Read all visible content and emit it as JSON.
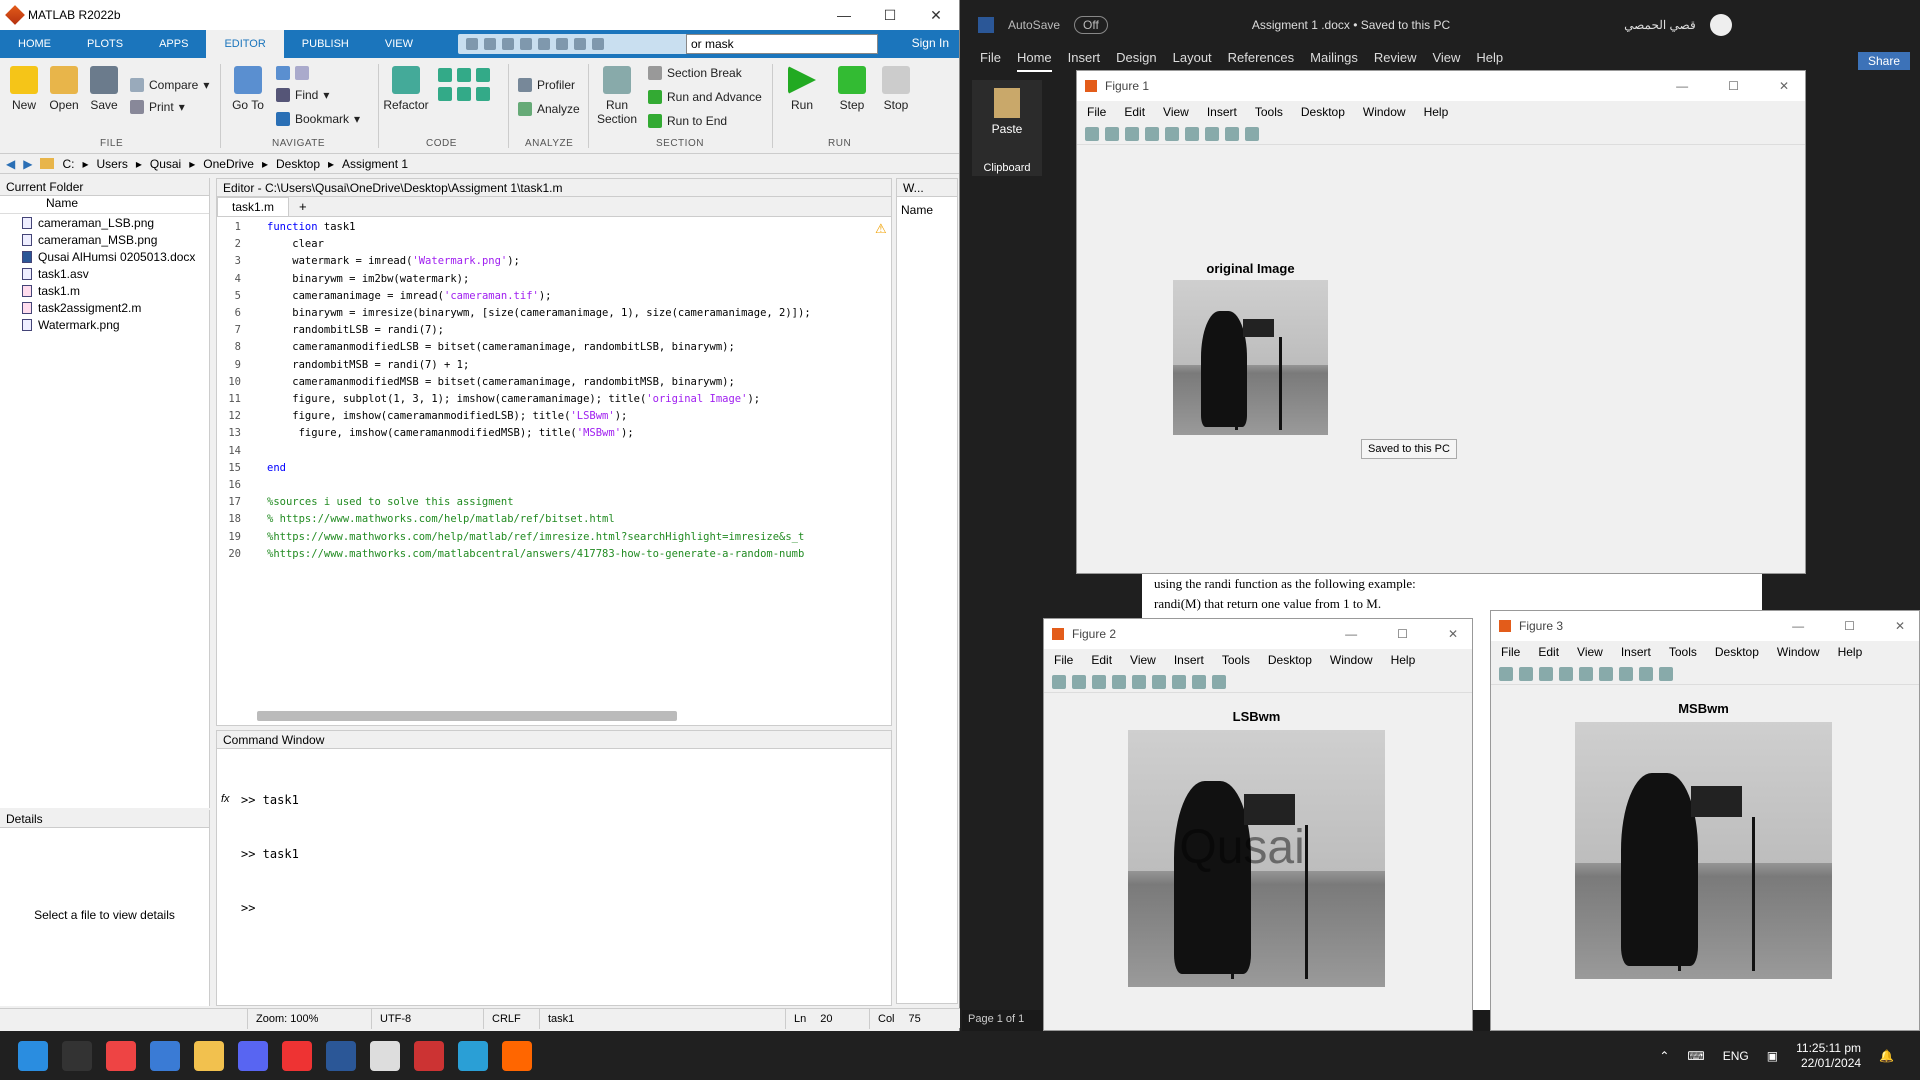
{
  "matlab": {
    "title": "MATLAB R2022b",
    "tabs": [
      "HOME",
      "PLOTS",
      "APPS",
      "EDITOR",
      "PUBLISH",
      "VIEW"
    ],
    "search_value": "or mask",
    "sign_in": "Sign In",
    "ribbon": {
      "file": {
        "new": "New",
        "open": "Open",
        "save": "Save",
        "compare": "Compare",
        "print": "Print",
        "group": "FILE"
      },
      "navigate": {
        "goto": "Go To",
        "find": "Find",
        "bookmark": "Bookmark",
        "group": "NAVIGATE"
      },
      "code": {
        "refactor": "Refactor",
        "group": "CODE"
      },
      "analyze": {
        "profiler": "Profiler",
        "analyze": "Analyze",
        "group": "ANALYZE"
      },
      "section": {
        "run_section": "Run Section",
        "section_break": "Section Break",
        "run_advance": "Run and Advance",
        "run_end": "Run to End",
        "group": "SECTION"
      },
      "run": {
        "run": "Run",
        "step": "Step",
        "stop": "Stop",
        "group": "RUN"
      }
    },
    "path": [
      "C:",
      "Users",
      "Qusai",
      "OneDrive",
      "Desktop",
      "Assigment 1"
    ],
    "current_folder": {
      "title": "Current Folder",
      "col": "Name",
      "files": [
        "cameraman_LSB.png",
        "cameraman_MSB.png",
        "Qusai AlHumsi 0205013.docx",
        "task1.asv",
        "task1.m",
        "task2assigment2.m",
        "Watermark.png"
      ]
    },
    "details": {
      "title": "Details",
      "empty": "Select a file to view details"
    },
    "editor": {
      "title": "Editor - C:\\Users\\Qusai\\OneDrive\\Desktop\\Assigment 1\\task1.m",
      "tab": "task1.m",
      "plus": "+"
    },
    "workspace": {
      "title": "W...",
      "col": "Name"
    },
    "command_window": {
      "title": "Command Window",
      "lines": [
        ">> task1",
        ">> task1"
      ],
      "prompt": ">>",
      "fx": "fx"
    },
    "status": {
      "zoom": "Zoom: 100%",
      "encoding": "UTF-8",
      "eol": "CRLF",
      "file": "task1",
      "ln_label": "Ln",
      "ln": "20",
      "col_label": "Col",
      "col": "75"
    }
  },
  "word": {
    "autosave": "AutoSave",
    "autosave_state": "Off",
    "doc_title": "Assigment 1 .docx  •  Saved to this PC",
    "user": "قصي الحمصي",
    "menu": [
      "File",
      "Home",
      "Insert",
      "Design",
      "Layout",
      "References",
      "Mailings",
      "Review",
      "View",
      "Help"
    ],
    "share": "Share",
    "paste": "Paste",
    "clipboard": "Clipboard",
    "page_status": "Page 1 of 1",
    "doc_text": [
      "using the randi function as the following example:",
      "randi(M) that return one value from 1 to M."
    ],
    "saved_tooltip": "Saved to this PC"
  },
  "figures": [
    {
      "title": "Figure 1",
      "plot_title": "original Image"
    },
    {
      "title": "Figure 2",
      "plot_title": "LSBwm",
      "watermark": "Qusai"
    },
    {
      "title": "Figure 3",
      "plot_title": "MSBwm"
    }
  ],
  "figure_menu": [
    "File",
    "Edit",
    "View",
    "Insert",
    "Tools",
    "Desktop",
    "Window",
    "Help"
  ],
  "taskbar": {
    "lang": "ENG",
    "time": "11:25:11 pm",
    "date": "22/01/2024"
  }
}
